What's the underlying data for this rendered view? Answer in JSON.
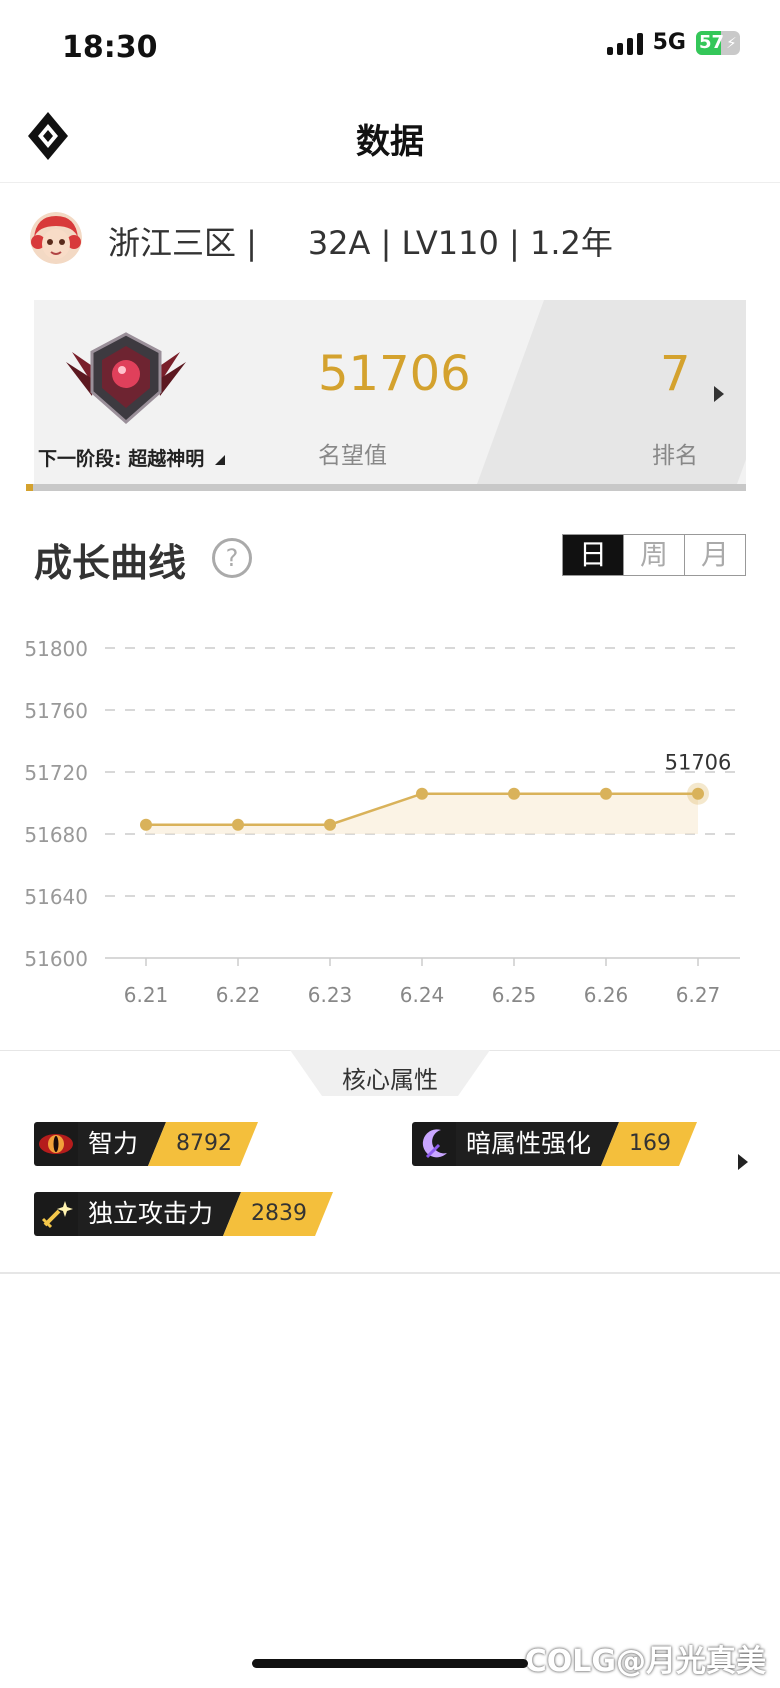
{
  "status_bar": {
    "time": "18:30",
    "network": "5G",
    "battery": "57"
  },
  "header": {
    "title": "数据",
    "logo_icon": "diamond-logo-icon"
  },
  "profile": {
    "line": "浙江三区 |     32A | LV110 | 1.2年"
  },
  "fame_card": {
    "next_stage": "下一阶段: 超越神明",
    "fame_value": "51706",
    "fame_label": "名望值",
    "rank_value": "7",
    "rank_label": "排名",
    "progress": 0.01
  },
  "growth": {
    "title": "成长曲线",
    "periods": [
      "日",
      "周",
      "月"
    ],
    "selected_period": "日"
  },
  "chart_data": {
    "type": "line",
    "x": [
      "6.21",
      "6.22",
      "6.23",
      "6.24",
      "6.25",
      "6.26",
      "6.27"
    ],
    "values": [
      51686,
      51686,
      51686,
      51706,
      51706,
      51706,
      51706
    ],
    "ylim": [
      51600,
      51800
    ],
    "yticks": [
      "51800",
      "51760",
      "51720",
      "51680",
      "51640",
      "51600"
    ],
    "last_label": "51706",
    "grid": true,
    "color": "#d9b25a"
  },
  "core": {
    "title": "核心属性",
    "attributes": [
      {
        "name": "智力",
        "value": "8792",
        "icon": "red-eye-icon"
      },
      {
        "name": "暗属性强化",
        "value": "169",
        "icon": "dark-moon-icon"
      },
      {
        "name": "独立攻击力",
        "value": "2839",
        "icon": "sparkle-sword-icon"
      }
    ]
  },
  "watermark": "COLG@月光真美"
}
